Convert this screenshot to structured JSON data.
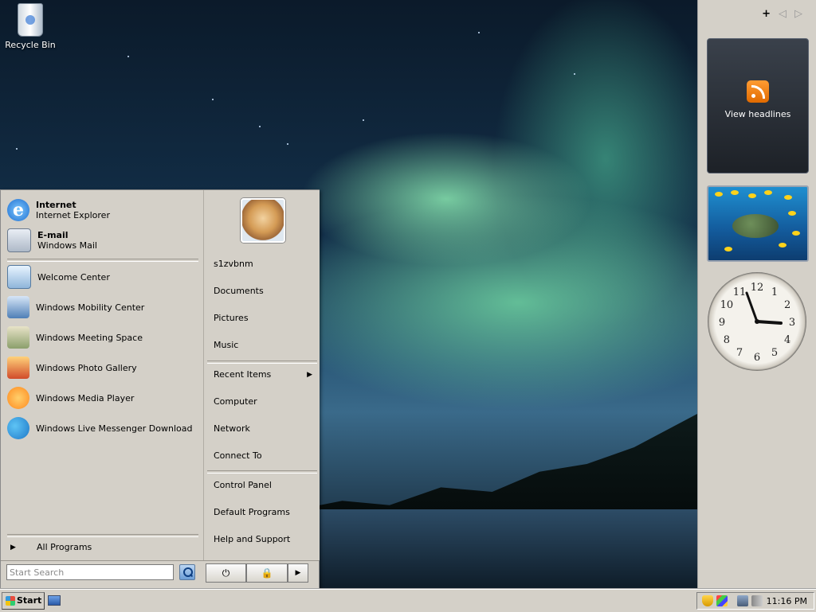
{
  "desktop": {
    "icons": [
      {
        "label": "Recycle Bin",
        "icon": "recycle-bin-icon"
      }
    ]
  },
  "sidebar": {
    "controls": {
      "add": "+",
      "prev": "◁",
      "next": "▷"
    },
    "feed_gadget": {
      "label": "View headlines",
      "icon": "rss-icon"
    },
    "slideshow": {
      "icon": "sea-turtle-image"
    },
    "clock": {
      "numbers": [
        "12",
        "1",
        "2",
        "3",
        "4",
        "5",
        "6",
        "7",
        "8",
        "9",
        "10",
        "11"
      ]
    }
  },
  "start_menu": {
    "pinned": [
      {
        "title": "Internet",
        "subtitle": "Internet Explorer",
        "icon": "internet-explorer-icon"
      },
      {
        "title": "E-mail",
        "subtitle": "Windows Mail",
        "icon": "windows-mail-icon"
      }
    ],
    "recent_programs": [
      {
        "label": "Welcome Center",
        "icon": "welcome-center-icon"
      },
      {
        "label": "Windows Mobility Center",
        "icon": "mobility-center-icon"
      },
      {
        "label": "Windows Meeting Space",
        "icon": "meeting-space-icon"
      },
      {
        "label": "Windows Photo Gallery",
        "icon": "photo-gallery-icon"
      },
      {
        "label": "Windows Media Player",
        "icon": "media-player-icon"
      },
      {
        "label": "Windows Live Messenger Download",
        "icon": "messenger-icon"
      }
    ],
    "all_programs": "All Programs",
    "search": {
      "placeholder": "Start Search"
    },
    "right_items": [
      {
        "label": "s1zvbnm"
      },
      {
        "label": "Documents"
      },
      {
        "label": "Pictures"
      },
      {
        "label": "Music"
      },
      {
        "label": "Recent Items",
        "arrow": "▶"
      },
      {
        "label": "Computer"
      },
      {
        "label": "Network"
      },
      {
        "label": "Connect To"
      },
      {
        "label": "Control Panel"
      },
      {
        "label": "Default Programs"
      },
      {
        "label": "Help and Support"
      }
    ],
    "power": {
      "power_glyph": "⏻",
      "lock_glyph": "🔒",
      "more_glyph": "▶"
    }
  },
  "taskbar": {
    "start_label": "Start",
    "clock": "11:16 PM"
  }
}
